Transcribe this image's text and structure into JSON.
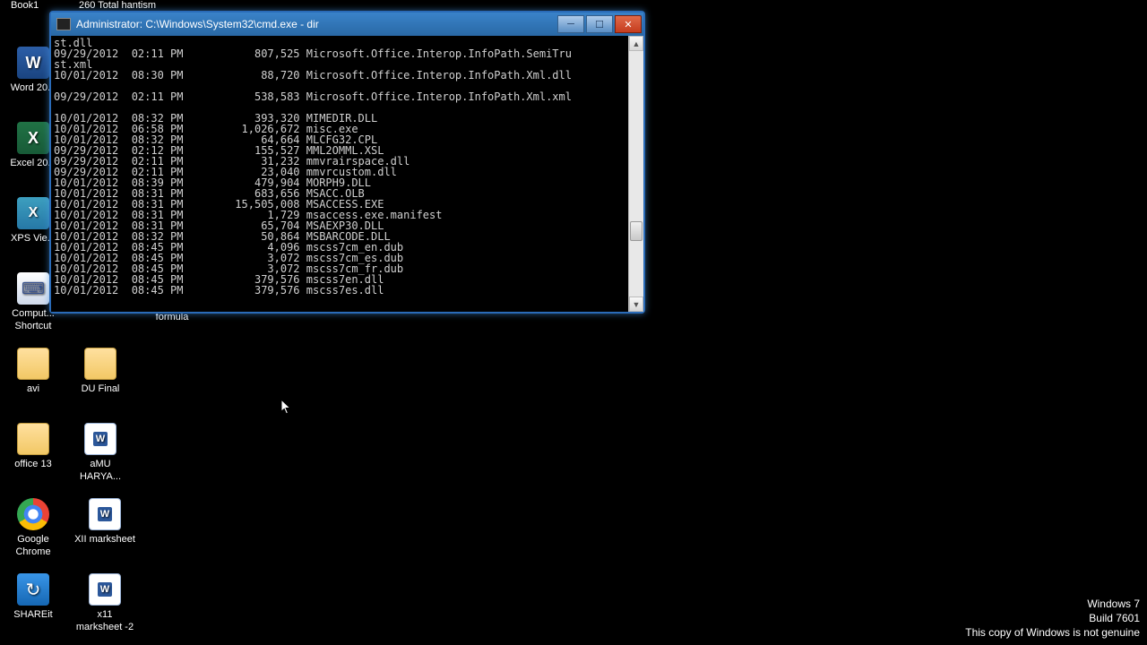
{
  "desktop_icons": {
    "book1": "Book1",
    "word": "Word 20...",
    "excel": "Excel 20...",
    "xps": "XPS Vie...",
    "comp_shortcut": "Comput...\nShortcut",
    "avi": "avi",
    "office13": "office 13",
    "chrome": "Google\nChrome",
    "shareit": "SHAREit",
    "top_right_partial": "260 Total        hantism",
    "formula": "formula",
    "du_final": "DU Final",
    "amu": "aMU\nHARYA...",
    "xii_marksheet": "XII marksheet",
    "x11_marksheet": "x11\nmarksheet -2"
  },
  "window": {
    "title": "Administrator: C:\\Windows\\System32\\cmd.exe - dir"
  },
  "cmd_output": "st.dll\n09/29/2012  02:11 PM           807,525 Microsoft.Office.Interop.InfoPath.SemiTru\nst.xml\n10/01/2012  08:30 PM            88,720 Microsoft.Office.Interop.InfoPath.Xml.dll\n\n09/29/2012  02:11 PM           538,583 Microsoft.Office.Interop.InfoPath.Xml.xml\n\n10/01/2012  08:32 PM           393,320 MIMEDIR.DLL\n10/01/2012  06:58 PM         1,026,672 misc.exe\n10/01/2012  08:32 PM            64,664 MLCFG32.CPL\n09/29/2012  02:12 PM           155,527 MML2OMML.XSL\n09/29/2012  02:11 PM            31,232 mmvrairspace.dll\n09/29/2012  02:11 PM            23,040 mmvrcustom.dll\n10/01/2012  08:39 PM           479,904 MORPH9.DLL\n10/01/2012  08:31 PM           683,656 MSACC.OLB\n10/01/2012  08:31 PM        15,505,008 MSACCESS.EXE\n10/01/2012  08:31 PM             1,729 msaccess.exe.manifest\n10/01/2012  08:31 PM            65,704 MSAEXP30.DLL\n10/01/2012  08:32 PM            50,864 MSBARCODE.DLL\n10/01/2012  08:45 PM             4,096 mscss7cm_en.dub\n10/01/2012  08:45 PM             3,072 mscss7cm_es.dub\n10/01/2012  08:45 PM             3,072 mscss7cm_fr.dub\n10/01/2012  08:45 PM           379,576 mscss7en.dll\n10/01/2012  08:45 PM           379,576 mscss7es.dll",
  "watermark": {
    "line1": "Windows 7",
    "line2": "Build 7601",
    "line3": "This copy of Windows is not genuine"
  }
}
